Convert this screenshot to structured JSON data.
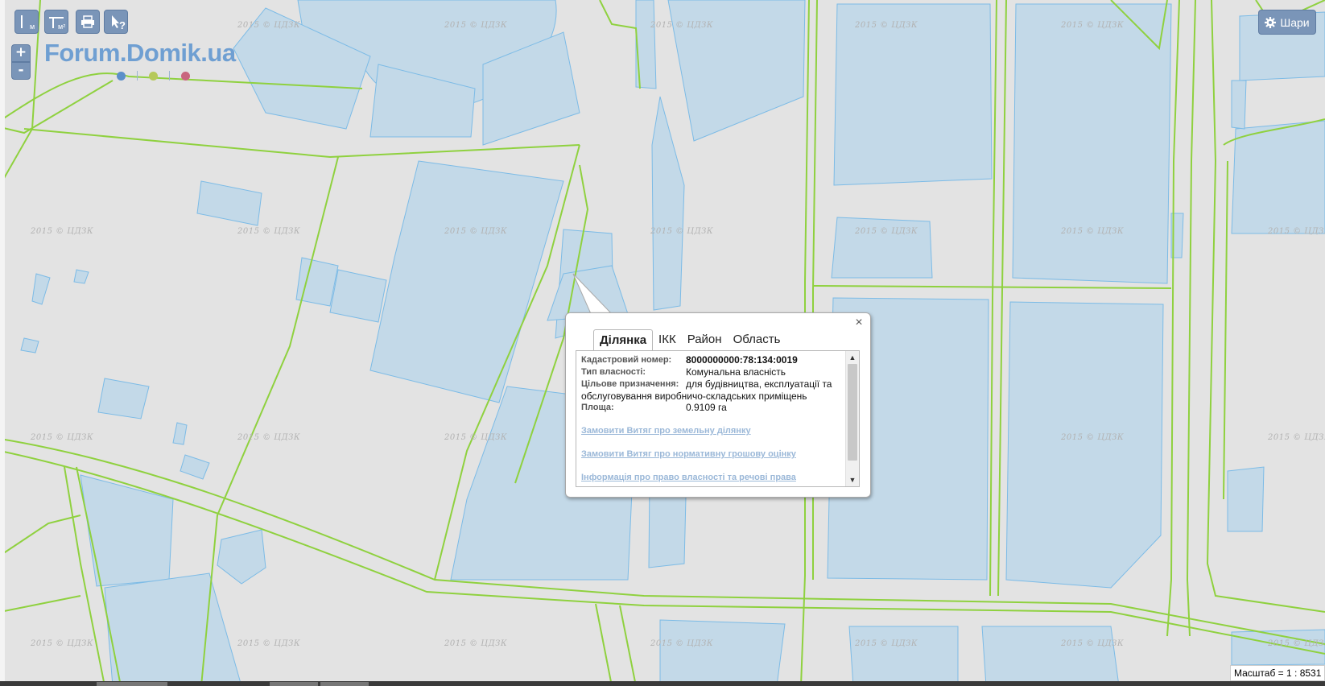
{
  "toolbar": {
    "buttons": [
      {
        "name": "measure-distance",
        "icon": "ruler-line-icon",
        "label": "м"
      },
      {
        "name": "measure-area",
        "icon": "ruler-area-icon",
        "label": "м²"
      },
      {
        "name": "print",
        "icon": "printer-icon",
        "label": ""
      },
      {
        "name": "identify",
        "icon": "cursor-question-icon",
        "label": "?"
      }
    ],
    "zoom_in": "+",
    "zoom_out": "-"
  },
  "logo": {
    "text": "Forum.Domik.ua",
    "dot_colors": [
      "#5b8fc9",
      "#b6c95a",
      "#c9667e"
    ]
  },
  "layers_button": {
    "label": "Шари",
    "icon": "gear-icon"
  },
  "watermark": "2015 © ЦДЗК",
  "popup": {
    "tabs": [
      "Ділянка",
      "ІКК",
      "Район",
      "Область"
    ],
    "active_tab": "Ділянка",
    "fields": [
      {
        "label": "Кадастровий номер:",
        "value": "8000000000:78:134:0019"
      },
      {
        "label": "Тип власності:",
        "value": "Комунальна власність"
      },
      {
        "label": "Цільове призначення:",
        "value": "для будівництва, експлуатації та обслуговування виробничо-складських приміщень"
      },
      {
        "label": "Площа:",
        "value": "0.9109 га"
      }
    ],
    "links": [
      "Замовити Витяг про земельну ділянку",
      "Замовити Витяг про нормативну грошову оцінку",
      "Інформація про право власності та речові права"
    ],
    "close": "×"
  },
  "scale": {
    "label": "Масштаб = 1 : 8531"
  },
  "colors": {
    "map_bg": "#e3e3e3",
    "parcel_fill": "#c3d9e8",
    "parcel_stroke": "#7cbbe6",
    "road": "#8fd13f",
    "button": "#7a95b8"
  }
}
